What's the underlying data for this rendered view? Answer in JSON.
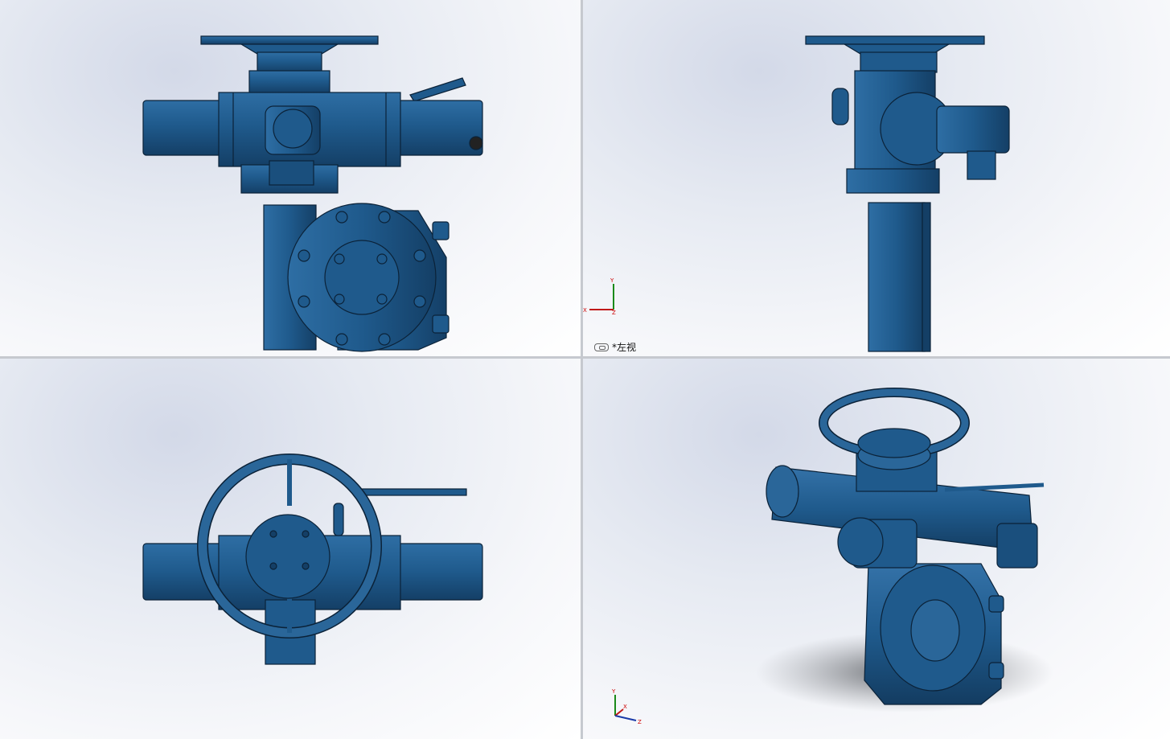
{
  "viewports": [
    {
      "id": "front",
      "label": ""
    },
    {
      "id": "left",
      "label": "*左视",
      "label_visible": true
    },
    {
      "id": "top",
      "label": ""
    },
    {
      "id": "iso",
      "label": ""
    }
  ],
  "triad_left": {
    "x": "X",
    "y": "Y",
    "z": "Z"
  },
  "triad_iso": {
    "x": "X",
    "y": "Y",
    "z": "Z"
  },
  "colors": {
    "body": "#1f5a8c",
    "body_dark": "#143f66",
    "body_light": "#3a78ad",
    "edge": "#0b2238",
    "shadow": "#6b6e73"
  }
}
